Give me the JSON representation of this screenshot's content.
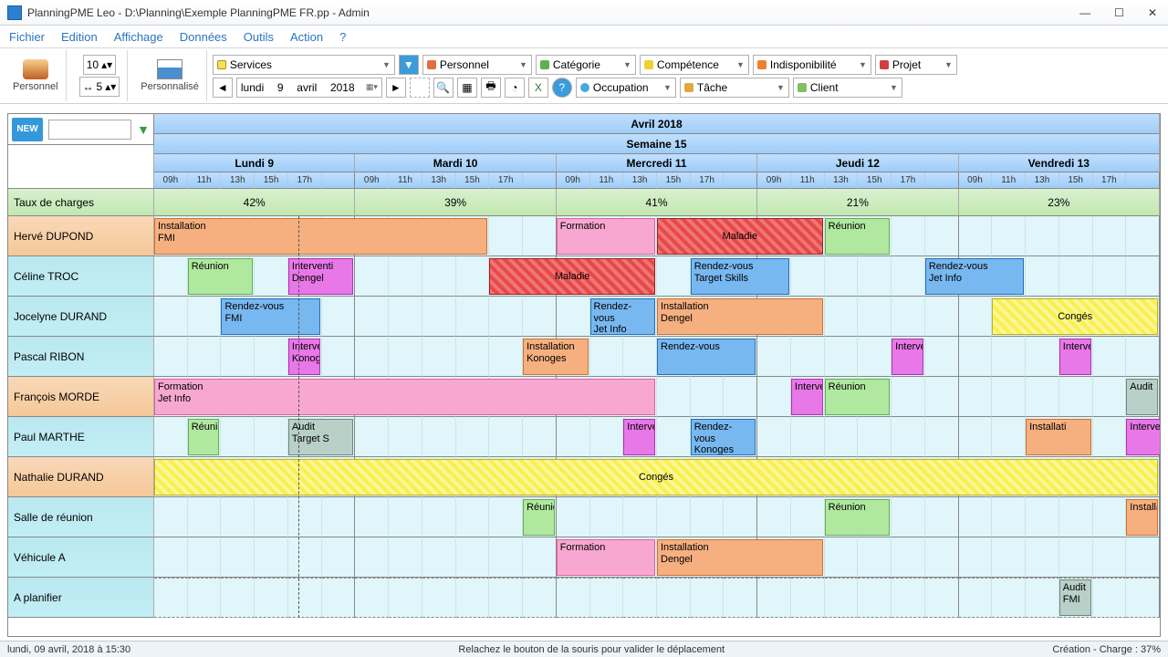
{
  "window": {
    "title": "PlanningPME Leo - D:\\Planning\\Exemple PlanningPME FR.pp - Admin"
  },
  "menu": [
    "Fichier",
    "Edition",
    "Affichage",
    "Données",
    "Outils",
    "Action",
    "?"
  ],
  "toolbar": {
    "personnel_btn": "Personnel",
    "personnalise_btn": "Personnalisé",
    "spin1": "10",
    "spin2": "5",
    "date_nav": {
      "day": "lundi",
      "num": "9",
      "month": "avril",
      "year": "2018"
    },
    "filters": {
      "services": "Services",
      "personnel": "Personnel",
      "categorie": "Catégorie",
      "competence": "Compétence",
      "indispo": "Indisponibilité",
      "projet": "Projet",
      "occupation": "Occupation",
      "tache": "Tâche",
      "client": "Client"
    }
  },
  "new_label": "NEW",
  "header": {
    "month": "Avril 2018",
    "week": "Semaine 15"
  },
  "days": [
    "Lundi 9",
    "Mardi 10",
    "Mercredi 11",
    "Jeudi 12",
    "Vendredi 13"
  ],
  "hours": [
    "09h",
    "11h",
    "13h",
    "15h",
    "17h"
  ],
  "charge_label": "Taux de charges",
  "charges": [
    "42%",
    "39%",
    "41%",
    "21%",
    "23%"
  ],
  "resources": [
    {
      "name": "Hervé DUPOND",
      "style": "alt"
    },
    {
      "name": "Céline TROC",
      "style": ""
    },
    {
      "name": "Jocelyne DURAND",
      "style": ""
    },
    {
      "name": "Pascal RIBON",
      "style": ""
    },
    {
      "name": "François MORDE",
      "style": "alt"
    },
    {
      "name": "Paul MARTHE",
      "style": ""
    },
    {
      "name": "Nathalie DURAND",
      "style": "alt"
    },
    {
      "name": "Salle de réunion",
      "style": ""
    },
    {
      "name": "Véhicule A",
      "style": ""
    },
    {
      "name": "A planifier",
      "style": ""
    }
  ],
  "tasks": [
    {
      "row": 0,
      "start": 0,
      "span": 10,
      "cls": "installation",
      "text": "Installation\nFMI"
    },
    {
      "row": 0,
      "start": 12,
      "span": 3,
      "cls": "formation",
      "text": "Formation"
    },
    {
      "row": 0,
      "start": 15,
      "span": 5,
      "cls": "maladie",
      "text": "Maladie"
    },
    {
      "row": 0,
      "start": 20,
      "span": 2,
      "cls": "reunion",
      "text": "Réunion"
    },
    {
      "row": 1,
      "start": 1,
      "span": 2,
      "cls": "reunion",
      "text": "Réunion"
    },
    {
      "row": 1,
      "start": 4,
      "span": 2,
      "cls": "intervention",
      "text": "Interventi\nDengel"
    },
    {
      "row": 1,
      "start": 10,
      "span": 5,
      "cls": "maladie",
      "text": "Maladie"
    },
    {
      "row": 1,
      "start": 16,
      "span": 3,
      "cls": "rendezvous",
      "text": "Rendez-vous\nTarget Skills"
    },
    {
      "row": 1,
      "start": 23,
      "span": 3,
      "cls": "rendezvous",
      "text": "Rendez-vous\nJet Info"
    },
    {
      "row": 2,
      "start": 2,
      "span": 3,
      "cls": "rendezvous",
      "text": "Rendez-vous\nFMI"
    },
    {
      "row": 2,
      "start": 13,
      "span": 2,
      "cls": "rendezvous",
      "text": "Rendez-vous\nJet Info"
    },
    {
      "row": 2,
      "start": 15,
      "span": 5,
      "cls": "installation",
      "text": "Installation\nDengel"
    },
    {
      "row": 2,
      "start": 25,
      "span": 5,
      "cls": "conges",
      "text": "Congés"
    },
    {
      "row": 3,
      "start": 4,
      "span": 1,
      "cls": "intervention",
      "text": "Interventi\nKonoges"
    },
    {
      "row": 3,
      "start": 11,
      "span": 2,
      "cls": "installation",
      "text": "Installation\nKonoges"
    },
    {
      "row": 3,
      "start": 15,
      "span": 3,
      "cls": "rendezvous",
      "text": "Rendez-vous"
    },
    {
      "row": 3,
      "start": 22,
      "span": 1,
      "cls": "intervention",
      "text": "Interven"
    },
    {
      "row": 3,
      "start": 27,
      "span": 1,
      "cls": "intervention",
      "text": "Interven"
    },
    {
      "row": 4,
      "start": 0,
      "span": 15,
      "cls": "formation",
      "text": "Formation\nJet Info"
    },
    {
      "row": 4,
      "start": 19,
      "span": 1,
      "cls": "intervention",
      "text": "Interven"
    },
    {
      "row": 4,
      "start": 20,
      "span": 2,
      "cls": "reunion",
      "text": "Réunion"
    },
    {
      "row": 4,
      "start": 29,
      "span": 1,
      "cls": "audit",
      "text": "Audit"
    },
    {
      "row": 5,
      "start": 1,
      "span": 1,
      "cls": "reunion",
      "text": "Réunion"
    },
    {
      "row": 5,
      "start": 4,
      "span": 2,
      "cls": "audit",
      "text": "Audit\nTarget S"
    },
    {
      "row": 5,
      "start": 14,
      "span": 1,
      "cls": "intervention",
      "text": "Interven"
    },
    {
      "row": 5,
      "start": 16,
      "span": 2,
      "cls": "rendezvous",
      "text": "Rendez-vous\nKonoges"
    },
    {
      "row": 5,
      "start": 26,
      "span": 2,
      "cls": "installation",
      "text": "Installati"
    },
    {
      "row": 5,
      "start": 29,
      "span": 3,
      "cls": "intervention",
      "text": "Intervention"
    },
    {
      "row": 6,
      "start": 0,
      "span": 30,
      "cls": "conges",
      "text": "Congés"
    },
    {
      "row": 7,
      "start": 11,
      "span": 1,
      "cls": "reunion",
      "text": "Réunion"
    },
    {
      "row": 7,
      "start": 20,
      "span": 2,
      "cls": "reunion",
      "text": "Réunion"
    },
    {
      "row": 7,
      "start": 29,
      "span": 1,
      "cls": "installation",
      "text": "Installati"
    },
    {
      "row": 8,
      "start": 12,
      "span": 3,
      "cls": "formation",
      "text": "Formation"
    },
    {
      "row": 8,
      "start": 15,
      "span": 5,
      "cls": "installation",
      "text": "Installation\nDengel"
    },
    {
      "row": 9,
      "start": 27,
      "span": 1,
      "cls": "audit",
      "text": "Audit\nFMI"
    }
  ],
  "status": {
    "left": "lundi, 09 avril, 2018 à 15:30",
    "center": "Relachez le bouton de la souris pour valider le déplacement",
    "right": "Création - Charge : 37%"
  }
}
